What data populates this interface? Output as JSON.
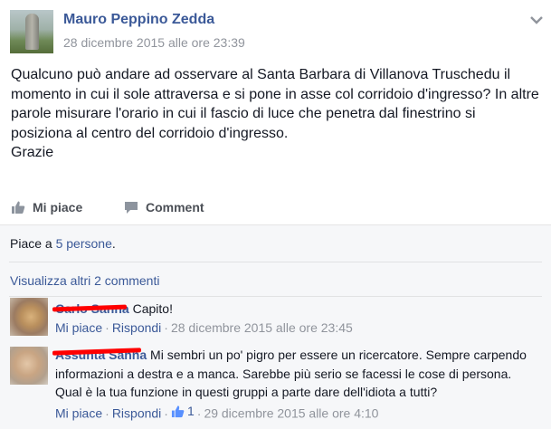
{
  "post": {
    "author": "Mauro Peppino Zedda",
    "timestamp": "28 dicembre 2015 alle ore 23:39",
    "body": "Qualcuno può andare ad osservare al Santa Barbara di Villanova Truschedu il momento in cui il sole attraversa e si pone in asse col corridoio d'ingresso? In altre parole misurare l'orario in cui il fascio di luce che penetra dal finestrino si posiziona al centro del corridoio d'ingresso.",
    "closing": "Grazie"
  },
  "actions": {
    "like_label": "Mi piace",
    "comment_label": "Comment"
  },
  "likes": {
    "prefix": "Piace a ",
    "link": "5 persone",
    "suffix": "."
  },
  "more_comments": "Visualizza altri 2 commenti",
  "comments": [
    {
      "author": "Carlo Sanna",
      "text": "Capito!",
      "like_label": "Mi piace",
      "reply_label": "Rispondi",
      "timestamp": "28 dicembre 2015 alle ore 23:45"
    },
    {
      "author": "Assunta Sanna",
      "text": "Mi sembri un po' pigro per essere un ricercatore. Sempre carpendo informazioni a destra e a manca. Sarebbe più serio se facessi le cose di persona. Qual è la tua funzione in questi gruppi a parte dare dell'idiota a tutti?",
      "like_label": "Mi piace",
      "reply_label": "Rispondi",
      "like_count": "1",
      "timestamp": "29 dicembre 2015 alle ore 4:10"
    }
  ],
  "colors": {
    "link": "#3b5998",
    "meta": "#90949c",
    "redaction": "#ff0000"
  }
}
